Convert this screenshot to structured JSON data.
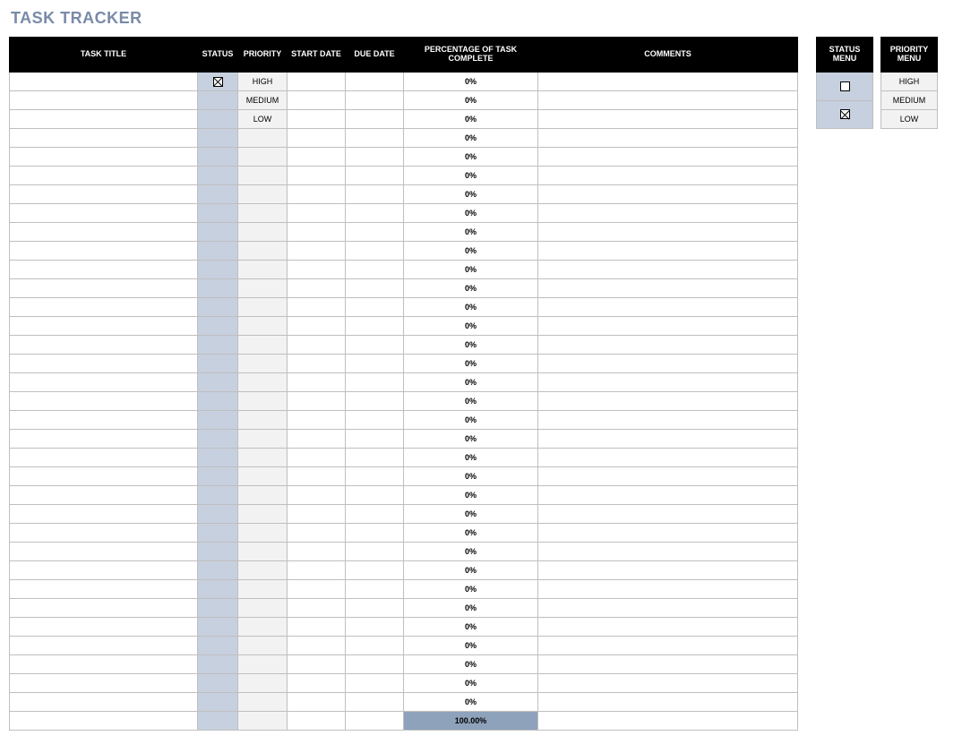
{
  "title": "TASK TRACKER",
  "columns": {
    "task_title": "TASK TITLE",
    "status": "STATUS",
    "priority": "PRIORITY",
    "start_date": "START DATE",
    "due_date": "DUE DATE",
    "pct_complete": "PERCENTAGE OF TASK COMPLETE",
    "comments": "COMMENTS"
  },
  "rows": [
    {
      "task_title": "",
      "status_checked": true,
      "priority": "HIGH",
      "start_date": "",
      "due_date": "",
      "pct": "0%",
      "comments": ""
    },
    {
      "task_title": "",
      "status_checked": false,
      "priority": "MEDIUM",
      "start_date": "",
      "due_date": "",
      "pct": "0%",
      "comments": ""
    },
    {
      "task_title": "",
      "status_checked": false,
      "priority": "LOW",
      "start_date": "",
      "due_date": "",
      "pct": "0%",
      "comments": ""
    },
    {
      "task_title": "",
      "status_checked": false,
      "priority": "",
      "start_date": "",
      "due_date": "",
      "pct": "0%",
      "comments": ""
    },
    {
      "task_title": "",
      "status_checked": false,
      "priority": "",
      "start_date": "",
      "due_date": "",
      "pct": "0%",
      "comments": ""
    },
    {
      "task_title": "",
      "status_checked": false,
      "priority": "",
      "start_date": "",
      "due_date": "",
      "pct": "0%",
      "comments": ""
    },
    {
      "task_title": "",
      "status_checked": false,
      "priority": "",
      "start_date": "",
      "due_date": "",
      "pct": "0%",
      "comments": ""
    },
    {
      "task_title": "",
      "status_checked": false,
      "priority": "",
      "start_date": "",
      "due_date": "",
      "pct": "0%",
      "comments": ""
    },
    {
      "task_title": "",
      "status_checked": false,
      "priority": "",
      "start_date": "",
      "due_date": "",
      "pct": "0%",
      "comments": ""
    },
    {
      "task_title": "",
      "status_checked": false,
      "priority": "",
      "start_date": "",
      "due_date": "",
      "pct": "0%",
      "comments": ""
    },
    {
      "task_title": "",
      "status_checked": false,
      "priority": "",
      "start_date": "",
      "due_date": "",
      "pct": "0%",
      "comments": ""
    },
    {
      "task_title": "",
      "status_checked": false,
      "priority": "",
      "start_date": "",
      "due_date": "",
      "pct": "0%",
      "comments": ""
    },
    {
      "task_title": "",
      "status_checked": false,
      "priority": "",
      "start_date": "",
      "due_date": "",
      "pct": "0%",
      "comments": ""
    },
    {
      "task_title": "",
      "status_checked": false,
      "priority": "",
      "start_date": "",
      "due_date": "",
      "pct": "0%",
      "comments": ""
    },
    {
      "task_title": "",
      "status_checked": false,
      "priority": "",
      "start_date": "",
      "due_date": "",
      "pct": "0%",
      "comments": ""
    },
    {
      "task_title": "",
      "status_checked": false,
      "priority": "",
      "start_date": "",
      "due_date": "",
      "pct": "0%",
      "comments": ""
    },
    {
      "task_title": "",
      "status_checked": false,
      "priority": "",
      "start_date": "",
      "due_date": "",
      "pct": "0%",
      "comments": ""
    },
    {
      "task_title": "",
      "status_checked": false,
      "priority": "",
      "start_date": "",
      "due_date": "",
      "pct": "0%",
      "comments": ""
    },
    {
      "task_title": "",
      "status_checked": false,
      "priority": "",
      "start_date": "",
      "due_date": "",
      "pct": "0%",
      "comments": ""
    },
    {
      "task_title": "",
      "status_checked": false,
      "priority": "",
      "start_date": "",
      "due_date": "",
      "pct": "0%",
      "comments": ""
    },
    {
      "task_title": "",
      "status_checked": false,
      "priority": "",
      "start_date": "",
      "due_date": "",
      "pct": "0%",
      "comments": ""
    },
    {
      "task_title": "",
      "status_checked": false,
      "priority": "",
      "start_date": "",
      "due_date": "",
      "pct": "0%",
      "comments": ""
    },
    {
      "task_title": "",
      "status_checked": false,
      "priority": "",
      "start_date": "",
      "due_date": "",
      "pct": "0%",
      "comments": ""
    },
    {
      "task_title": "",
      "status_checked": false,
      "priority": "",
      "start_date": "",
      "due_date": "",
      "pct": "0%",
      "comments": ""
    },
    {
      "task_title": "",
      "status_checked": false,
      "priority": "",
      "start_date": "",
      "due_date": "",
      "pct": "0%",
      "comments": ""
    },
    {
      "task_title": "",
      "status_checked": false,
      "priority": "",
      "start_date": "",
      "due_date": "",
      "pct": "0%",
      "comments": ""
    },
    {
      "task_title": "",
      "status_checked": false,
      "priority": "",
      "start_date": "",
      "due_date": "",
      "pct": "0%",
      "comments": ""
    },
    {
      "task_title": "",
      "status_checked": false,
      "priority": "",
      "start_date": "",
      "due_date": "",
      "pct": "0%",
      "comments": ""
    },
    {
      "task_title": "",
      "status_checked": false,
      "priority": "",
      "start_date": "",
      "due_date": "",
      "pct": "0%",
      "comments": ""
    },
    {
      "task_title": "",
      "status_checked": false,
      "priority": "",
      "start_date": "",
      "due_date": "",
      "pct": "0%",
      "comments": ""
    },
    {
      "task_title": "",
      "status_checked": false,
      "priority": "",
      "start_date": "",
      "due_date": "",
      "pct": "0%",
      "comments": ""
    },
    {
      "task_title": "",
      "status_checked": false,
      "priority": "",
      "start_date": "",
      "due_date": "",
      "pct": "0%",
      "comments": ""
    },
    {
      "task_title": "",
      "status_checked": false,
      "priority": "",
      "start_date": "",
      "due_date": "",
      "pct": "0%",
      "comments": ""
    },
    {
      "task_title": "",
      "status_checked": false,
      "priority": "",
      "start_date": "",
      "due_date": "",
      "pct": "0%",
      "comments": ""
    }
  ],
  "total_pct": "100.00%",
  "status_menu": {
    "header": "STATUS MENU",
    "options": [
      {
        "checked": false
      },
      {
        "checked": true
      }
    ]
  },
  "priority_menu": {
    "header": "PRIORITY MENU",
    "options": [
      "HIGH",
      "MEDIUM",
      "LOW"
    ]
  }
}
